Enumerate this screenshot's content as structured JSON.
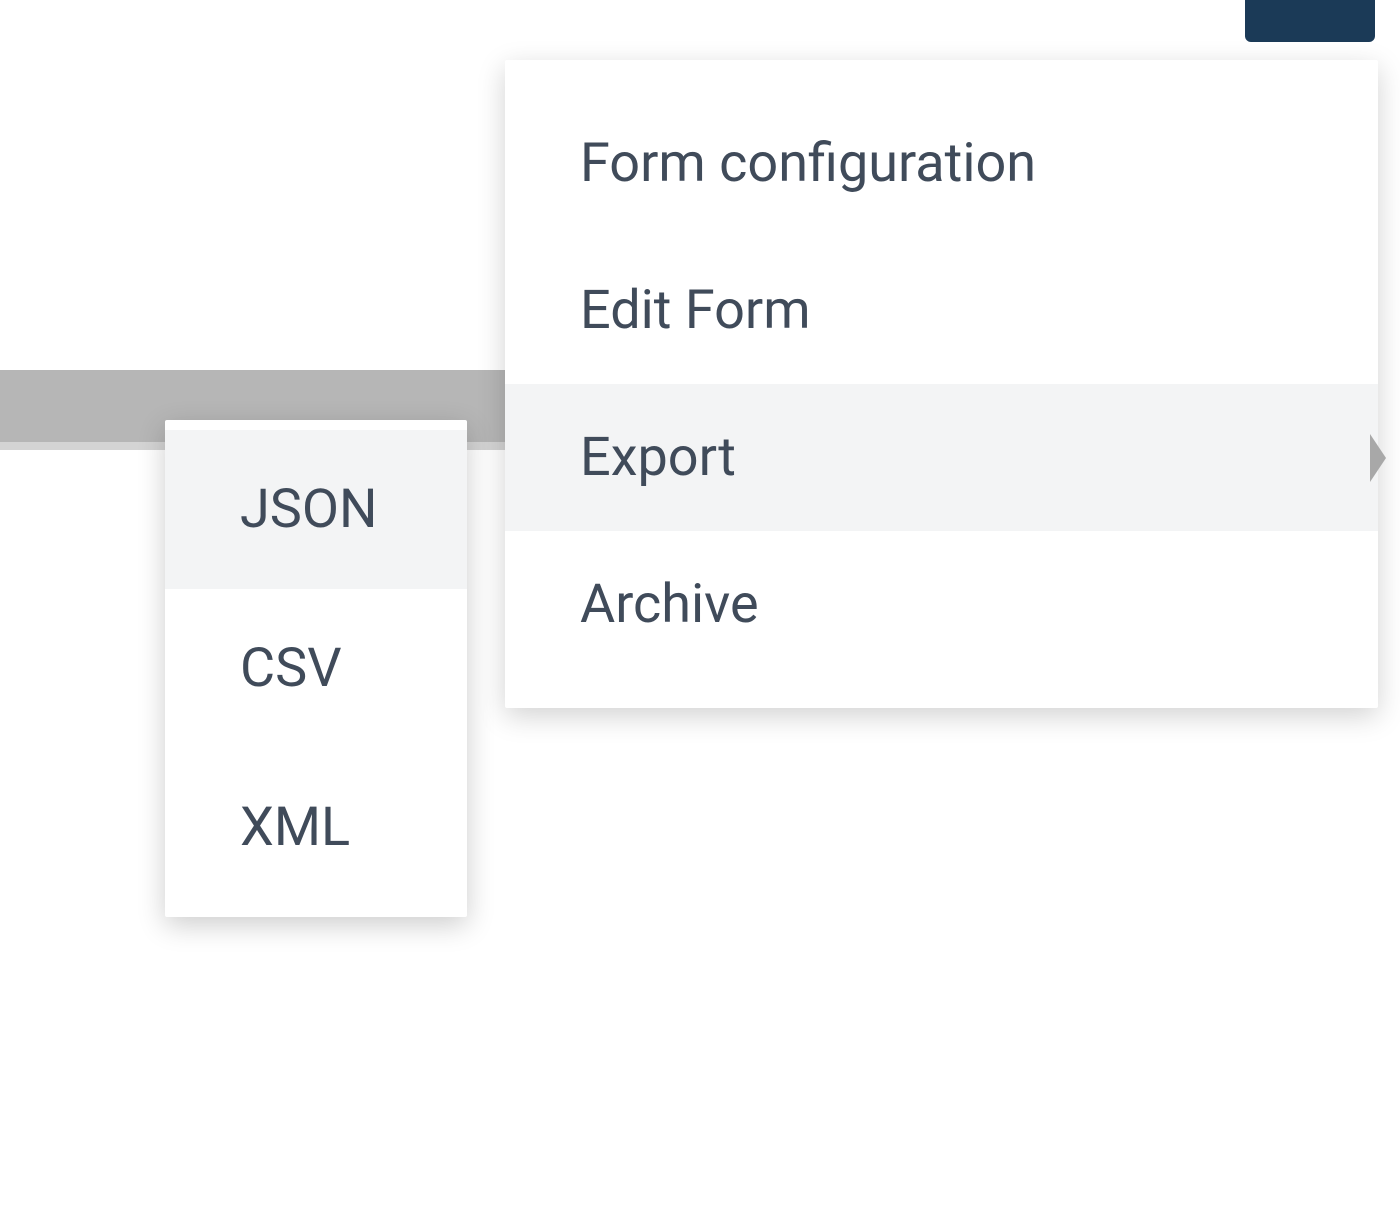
{
  "colors": {
    "topButtonBg": "#1b3a57",
    "menuText": "#404b5a",
    "hoverBg": "#f3f4f5",
    "barBg": "#b6b6b6"
  },
  "primaryMenu": {
    "items": [
      {
        "label": "Form configuration",
        "hovered": false,
        "hasSubmenu": false
      },
      {
        "label": "Edit Form",
        "hovered": false,
        "hasSubmenu": false
      },
      {
        "label": "Export",
        "hovered": true,
        "hasSubmenu": true
      },
      {
        "label": "Archive",
        "hovered": false,
        "hasSubmenu": false
      }
    ]
  },
  "submenu": {
    "items": [
      {
        "label": "JSON",
        "hovered": true
      },
      {
        "label": "CSV",
        "hovered": false
      },
      {
        "label": "XML",
        "hovered": false
      }
    ]
  }
}
